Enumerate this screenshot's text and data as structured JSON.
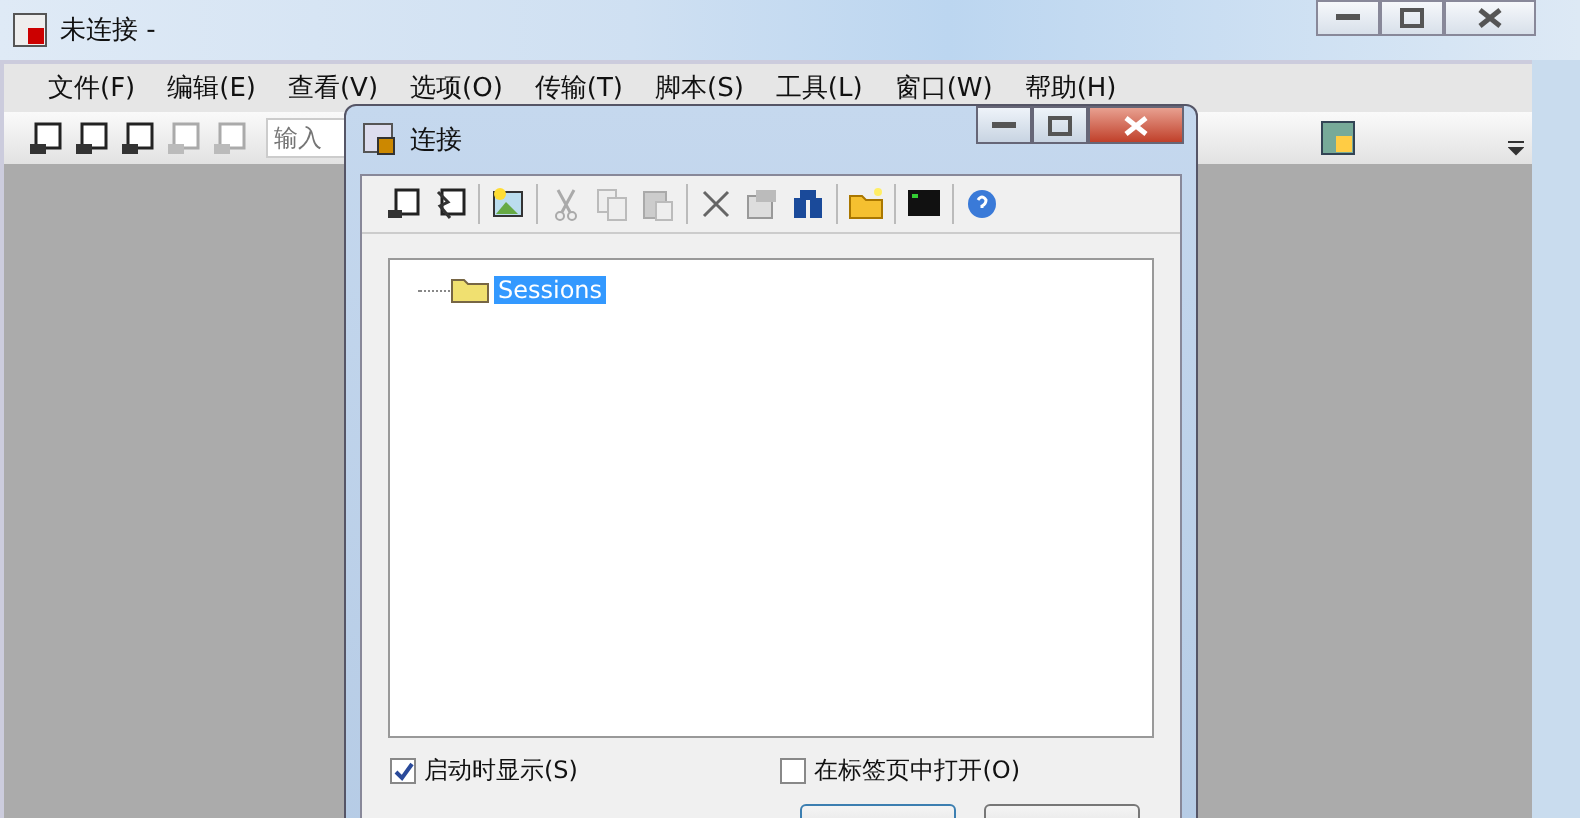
{
  "main_window": {
    "title": "未连接 -",
    "menu": [
      "文件(F)",
      "编辑(E)",
      "查看(V)",
      "选项(O)",
      "传输(T)",
      "脚本(S)",
      "工具(L)",
      "窗口(W)",
      "帮助(H)"
    ],
    "toolbar_input": {
      "placeholder": "输入"
    }
  },
  "dialog": {
    "title": "连接",
    "tree": [
      {
        "label": "Sessions",
        "selected": true
      }
    ],
    "options": [
      {
        "label": "启动时显示(S)",
        "checked": true
      },
      {
        "label": "在标签页中打开(O)",
        "checked": false
      }
    ]
  }
}
